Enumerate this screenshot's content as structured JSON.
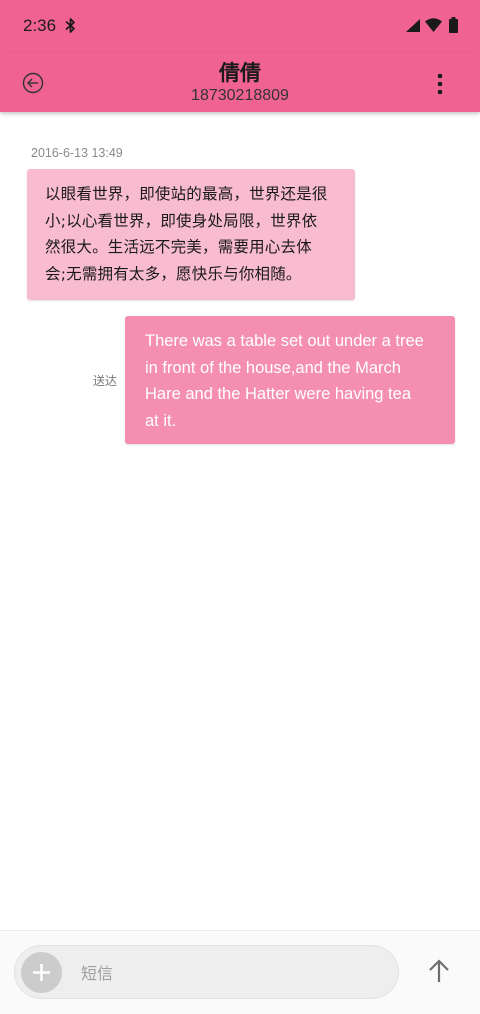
{
  "status_bar": {
    "time": "2:36",
    "icons": [
      "bluetooth-icon",
      "signal-icon",
      "wifi-icon",
      "battery-icon"
    ]
  },
  "app_bar": {
    "contact_name": "倩倩",
    "contact_number": "18730218809",
    "icons": [
      "back-arrow-circle-icon",
      "more-vert-icon"
    ],
    "background_color": "#f06292"
  },
  "conversation": {
    "timestamp": "2016-6-13 13:49",
    "incoming": {
      "lines": [
        "以眼看世界，即使站的最高，世界还是很",
        "小;以心看世界，即使身处局限，世界依",
        "然很大。生活远不完美，需要用心去体",
        "会;无需拥有太多，愿快乐与你相随。"
      ],
      "bubble_color": "#f8bbd0"
    },
    "outgoing": {
      "status": "送达",
      "lines": [
        "There was a table set out under a tree",
        "in front of the house,and the March",
        "Hare and the Hatter were having tea",
        "at it."
      ],
      "bubble_color": "#f48fb1"
    }
  },
  "composer": {
    "placeholder": "短信",
    "value": "",
    "icons": [
      "add-icon",
      "send-arrow-up-icon"
    ]
  }
}
